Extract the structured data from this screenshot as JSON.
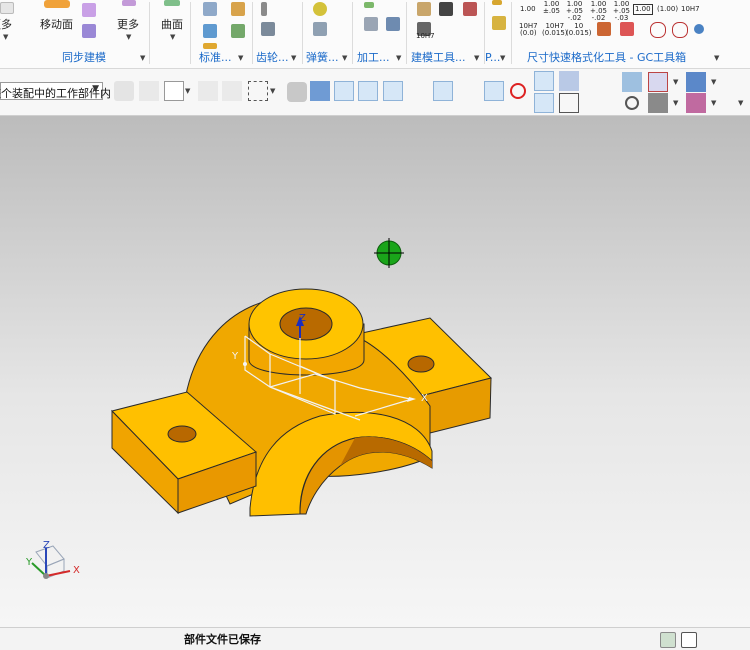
{
  "ribbon": {
    "groups": [
      {
        "label": "同步建模"
      },
      {
        "label": "标准..."
      },
      {
        "label": "齿轮..."
      },
      {
        "label": "弹簧..."
      },
      {
        "label": "加工..."
      },
      {
        "label": "建模工具..."
      },
      {
        "label": "P..."
      },
      {
        "label": "尺寸快速格式化工具 - GC工具箱"
      }
    ],
    "buttons": {
      "more_left": "更多",
      "move_face": "移动面",
      "more": "更多",
      "surface": "曲面"
    },
    "dim_tools": {
      "row1": [
        "1.00",
        "1.00\n±.05",
        "1.00\n+.05\n-.02",
        "1.00\n+.05\n-.02",
        "1.00\n+.05\n-.03",
        "1.00",
        "(1.00)",
        "10H7"
      ],
      "row2": [
        "10H7\n(0.0)",
        "10H7\n(0.015)",
        "10\n(0.015)"
      ],
      "row3": [
        "10H7"
      ]
    }
  },
  "toolbar": {
    "selection_filter": "整个装配中的工作部件内"
  },
  "viewport": {
    "triad_axes": {
      "x": "X",
      "y": "Y",
      "z": "Z"
    },
    "part_color": "#f5b000",
    "part_shade": "#d78a00",
    "snap_marker_color": "#1aa51a"
  },
  "status": {
    "message": "部件文件已保存"
  }
}
